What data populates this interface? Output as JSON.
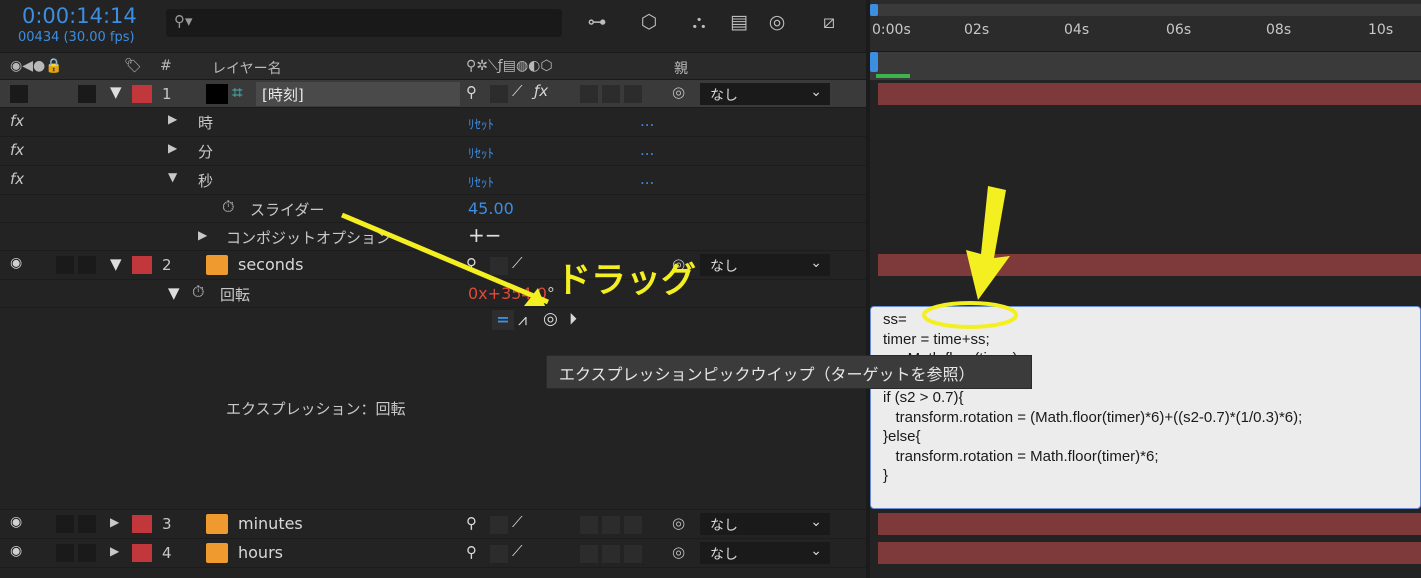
{
  "header": {
    "timecode": "0:00:14:14",
    "frame_fps": "00434 (30.00 fps)",
    "search_icon": "search-icon"
  },
  "columns": {
    "layer_num": "#",
    "layer_name": "レイヤー名",
    "parent": "親"
  },
  "layers": [
    {
      "num": "1",
      "name": "[時刻]",
      "parent": "なし"
    },
    {
      "num": "2",
      "name": "seconds",
      "parent": "なし"
    },
    {
      "num": "3",
      "name": "minutes",
      "parent": "なし"
    },
    {
      "num": "4",
      "name": "hours",
      "parent": "なし"
    }
  ],
  "effects": [
    {
      "name": "時",
      "reset": "ﾘｾｯﾄ",
      "more": "..."
    },
    {
      "name": "分",
      "reset": "ﾘｾｯﾄ",
      "more": "..."
    },
    {
      "name": "秒",
      "reset": "ﾘｾｯﾄ",
      "more": "..."
    }
  ],
  "fx_label": "fx",
  "slider": {
    "label": "スライダー",
    "value": "45.00"
  },
  "composite_options": {
    "label": "コンポジットオプション",
    "controls": "+−"
  },
  "rotation": {
    "label": "回転",
    "value_rev": "0x",
    "value_deg": "+354.0",
    "unit": "°"
  },
  "expression_label": "エクスプレッション：回転",
  "tooltip": "エクスプレッションピックウイップ（ターゲットを参照）",
  "annotation": {
    "drag": "ドラッグ"
  },
  "ruler": {
    "ticks": [
      "0:00s",
      "02s",
      "04s",
      "06s",
      "08s",
      "10s"
    ]
  },
  "expression_code": [
    "ss=",
    "timer = time+ss;",
    "s = Math.floor(timer);",
    "",
    "if (s2 > 0.7){",
    "   transform.rotation = (Math.floor(timer)*6)+((s2-0.7)*(1/0.3)*6);",
    "}else{",
    "   transform.rotation = Math.floor(timer)*6;",
    "}"
  ],
  "colors": {
    "accent_blue": "#3d8de0",
    "label_red": "#c2373b",
    "label_orange": "#ee9a2e",
    "annotation_yellow": "#f3ef21",
    "bar_red": "#7e3a3a"
  }
}
